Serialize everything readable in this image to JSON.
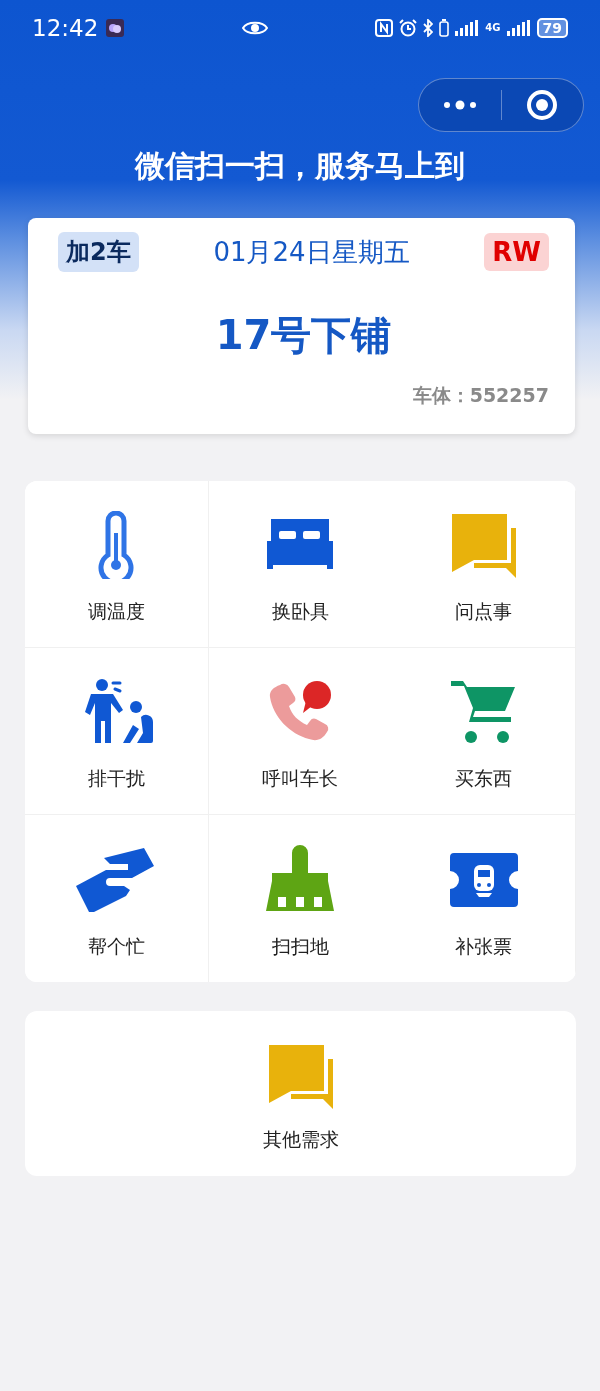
{
  "status_bar": {
    "time": "12:42",
    "network": "4G",
    "battery": "79"
  },
  "header": {
    "title": "微信扫一扫，服务马上到"
  },
  "ticket": {
    "coach": "加2车",
    "date": "01月24日星期五",
    "class": "RW",
    "berth": "17号下铺",
    "body_label": "车体：",
    "body_number": "552257"
  },
  "services": [
    {
      "label": "调温度",
      "kind": "thermometer"
    },
    {
      "label": "换卧具",
      "kind": "bed"
    },
    {
      "label": "问点事",
      "kind": "chat"
    },
    {
      "label": "排干扰",
      "kind": "disturb"
    },
    {
      "label": "呼叫车长",
      "kind": "phone"
    },
    {
      "label": "买东西",
      "kind": "cart"
    },
    {
      "label": "帮个忙",
      "kind": "handshake"
    },
    {
      "label": "扫扫地",
      "kind": "broom"
    },
    {
      "label": "补张票",
      "kind": "ticket"
    }
  ],
  "other": {
    "label": "其他需求",
    "kind": "chat"
  }
}
